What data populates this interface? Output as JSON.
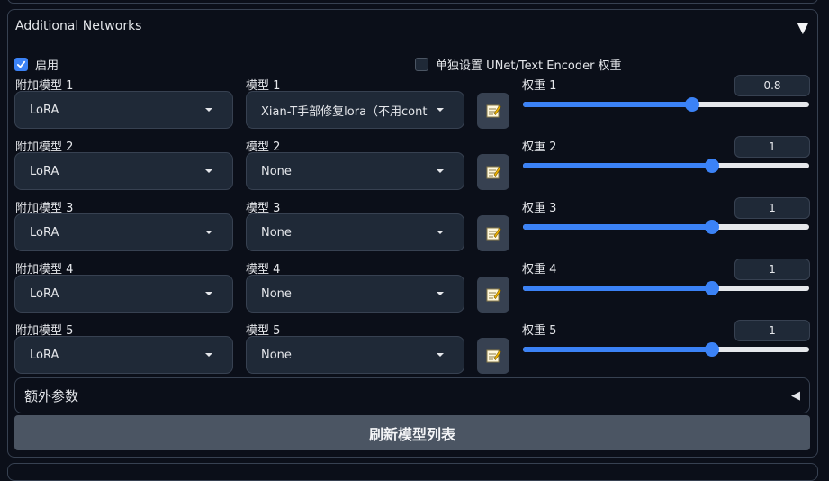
{
  "panel": {
    "title": "Additional Networks",
    "toggle_icon": "▼",
    "enable_label": "启用",
    "enable_checked": true,
    "separate_label": "单独设置 UNet/Text Encoder 权重",
    "separate_checked": false
  },
  "rows": [
    {
      "addon_label": "附加模型 1",
      "addon_value": "LoRA",
      "model_label": "模型 1",
      "model_value": "Xian-T手部修复lora（不用cont",
      "weight_label": "权重 1",
      "weight_value": "0.8",
      "weight_fraction": 0.59
    },
    {
      "addon_label": "附加模型 2",
      "addon_value": "LoRA",
      "model_label": "模型 2",
      "model_value": "None",
      "weight_label": "权重 2",
      "weight_value": "1",
      "weight_fraction": 0.66
    },
    {
      "addon_label": "附加模型 3",
      "addon_value": "LoRA",
      "model_label": "模型 3",
      "model_value": "None",
      "weight_label": "权重 3",
      "weight_value": "1",
      "weight_fraction": 0.66
    },
    {
      "addon_label": "附加模型 4",
      "addon_value": "LoRA",
      "model_label": "模型 4",
      "model_value": "None",
      "weight_label": "权重 4",
      "weight_value": "1",
      "weight_fraction": 0.66
    },
    {
      "addon_label": "附加模型 5",
      "addon_value": "LoRA",
      "model_label": "模型 5",
      "model_value": "None",
      "weight_label": "权重 5",
      "weight_value": "1",
      "weight_fraction": 0.66
    }
  ],
  "extra_params": {
    "label": "额外参数",
    "toggle_icon": "◀"
  },
  "refresh_button": "刷新模型列表",
  "colors": {
    "accent": "#3b82f6",
    "background": "#0b0f19",
    "control_bg": "#1f2937"
  }
}
